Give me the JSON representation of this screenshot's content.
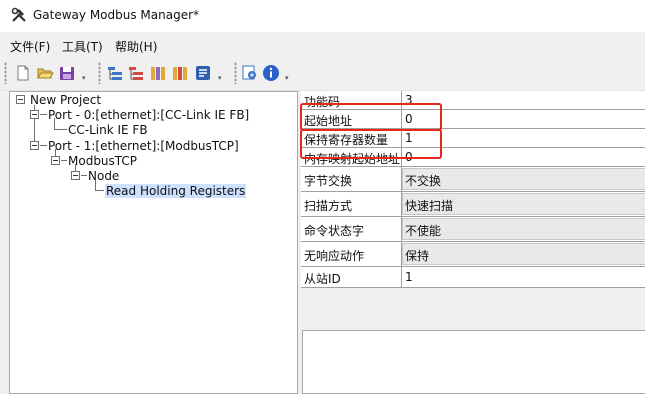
{
  "window": {
    "title": "Gateway Modbus Manager*",
    "icon": "tools-icon"
  },
  "menu": [
    {
      "label": "文件(F)"
    },
    {
      "label": "工具(T)"
    },
    {
      "label": "帮助(H)"
    }
  ],
  "toolbar": {
    "icons": [
      "new-file-icon",
      "open-folder-icon",
      "save-icon",
      "add-node-icon",
      "remove-node-icon",
      "import-icon",
      "export-icon",
      "settings-icon",
      "monitor-icon",
      "info-icon"
    ]
  },
  "tree": {
    "root": "New Project",
    "port0": "Port - 0:[ethernet]:[CC-Link IE FB]",
    "port0_child": "CC-Link IE FB",
    "port1": "Port - 1:[ethernet]:[ModbusTCP]",
    "modbus": "ModbusTCP",
    "node": "Node",
    "selected": "Read Holding Registers"
  },
  "properties": [
    {
      "label": "功能码",
      "value": "3"
    },
    {
      "label": "起始地址",
      "value": "0"
    },
    {
      "label": "保持寄存器数量",
      "value": "1"
    },
    {
      "label": "内存映射起始地址",
      "value": "0"
    },
    {
      "label": "字节交换",
      "value": "不交换"
    },
    {
      "label": "扫描方式",
      "value": "快速扫描"
    },
    {
      "label": "命令状态字",
      "value": "不使能"
    },
    {
      "label": "无响应动作",
      "value": "保持"
    },
    {
      "label": "从站ID",
      "value": "1"
    }
  ],
  "highlight_color": "#e8261c",
  "selection_color": "#cce0ff"
}
